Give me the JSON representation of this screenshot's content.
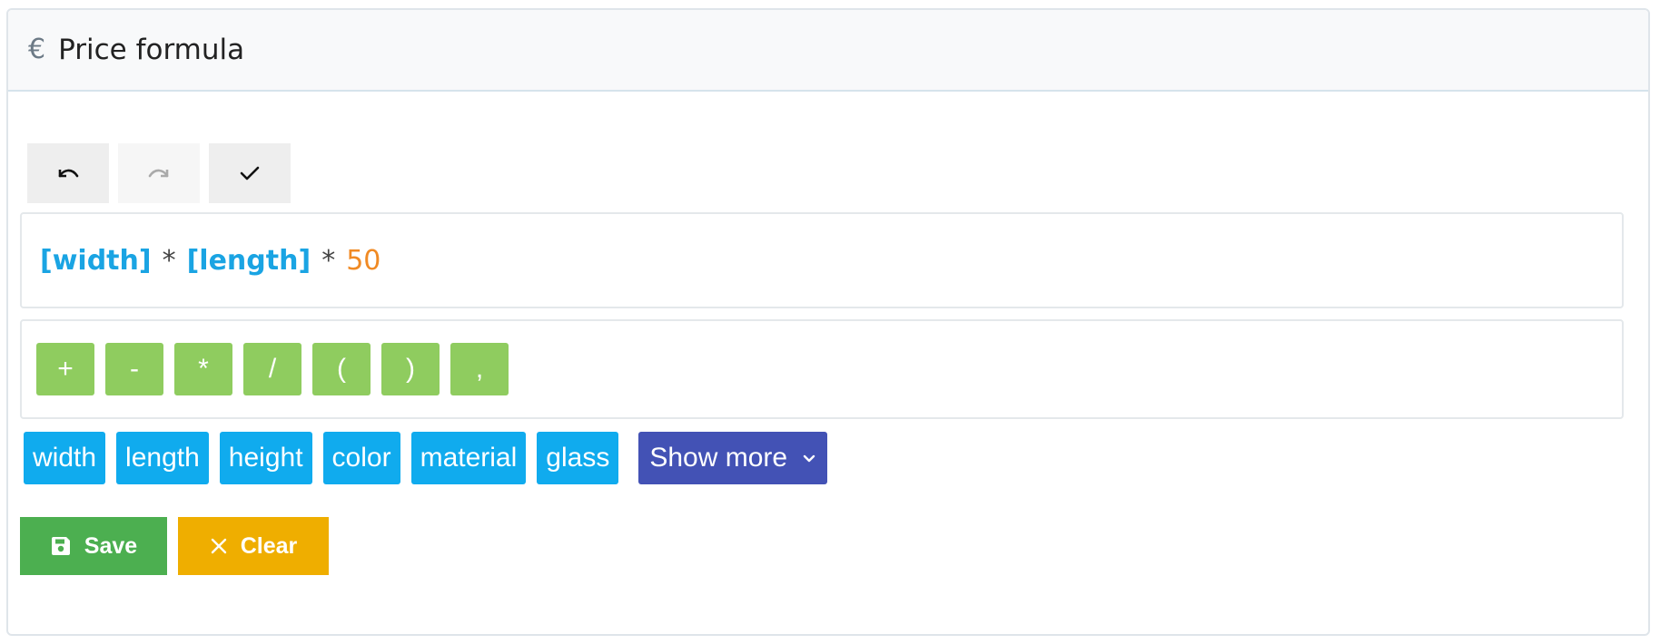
{
  "header": {
    "icon": "euro-icon",
    "icon_glyph": "€",
    "title": "Price formula"
  },
  "toolbar": {
    "undo": {
      "icon": "undo-icon",
      "enabled": true
    },
    "redo": {
      "icon": "redo-icon",
      "enabled": false
    },
    "validate": {
      "icon": "check-icon",
      "enabled": true
    }
  },
  "formula": {
    "tokens": [
      {
        "type": "variable",
        "text": "[width]"
      },
      {
        "type": "operator",
        "text": "*"
      },
      {
        "type": "variable",
        "text": "[length]"
      },
      {
        "type": "operator",
        "text": "*"
      },
      {
        "type": "number",
        "text": "50"
      }
    ]
  },
  "operators": [
    "+",
    "-",
    "*",
    "/",
    "(",
    ")",
    ","
  ],
  "variables": [
    "width",
    "length",
    "height",
    "color",
    "material",
    "glass"
  ],
  "show_more_label": "Show more",
  "actions": {
    "save_label": "Save",
    "clear_label": "Clear"
  },
  "colors": {
    "variable_token": "#1aa4e3",
    "number_token": "#f08a24",
    "operator_button": "#8fcc5f",
    "variable_button": "#10abee",
    "show_more_button": "#4352b5",
    "save_button": "#4caf50",
    "clear_button": "#efae00"
  }
}
